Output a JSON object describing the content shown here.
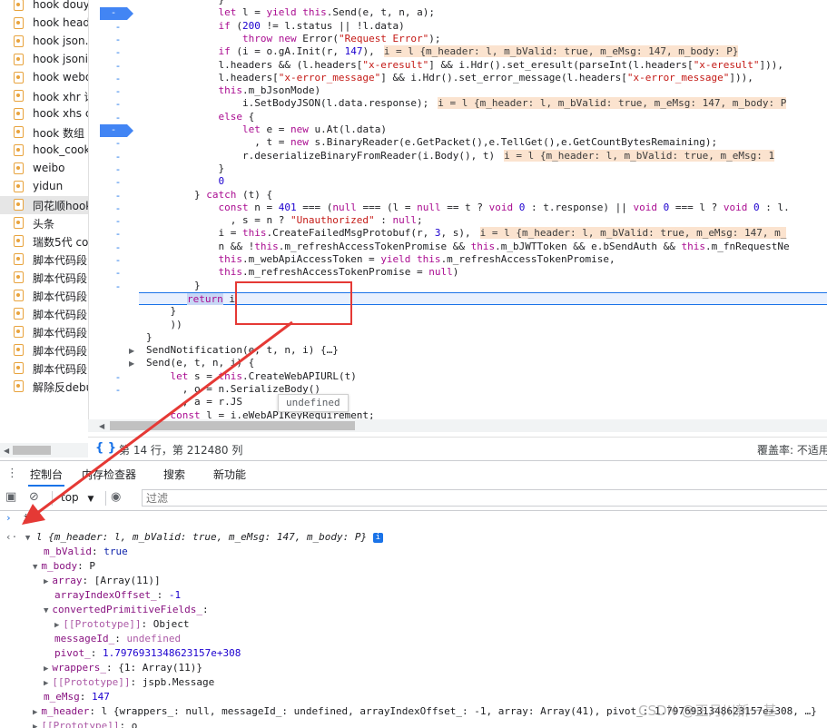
{
  "snippets": [
    {
      "name": "hook douyi"
    },
    {
      "name": "hook heade"
    },
    {
      "name": "hook json.p"
    },
    {
      "name": "hook jsonif"
    },
    {
      "name": "hook webd"
    },
    {
      "name": "hook xhr 请"
    },
    {
      "name": "hook xhs co"
    },
    {
      "name": "hook 数组"
    },
    {
      "name": "hook_cooki"
    },
    {
      "name": "weibo"
    },
    {
      "name": "yidun"
    },
    {
      "name": "同花顺hook",
      "selected": true
    },
    {
      "name": "头条"
    },
    {
      "name": "瑞数5代 co"
    },
    {
      "name": "脚本代码段"
    },
    {
      "name": "脚本代码段"
    },
    {
      "name": "脚本代码段"
    },
    {
      "name": "脚本代码段"
    },
    {
      "name": "脚本代码段"
    },
    {
      "name": "脚本代码段"
    },
    {
      "name": "脚本代码段"
    },
    {
      "name": "解除反debu"
    }
  ],
  "editor": {
    "lines": [
      "            }",
      "            let l = yield this.Send(e, t, n, a);",
      "            if (200 != l.status || !l.data)",
      "                throw new Error(\"Request Error\");",
      "            if (i = o.gA.Init(r, 147),",
      "            l.headers && (l.headers[\"x-eresult\"] && i.Hdr().set_eresult(parseInt(l.headers[\"x-eresult\"])),",
      "            l.headers[\"x-error_message\"] && i.Hdr().set_error_message(l.headers[\"x-error_message\"])),",
      "            this.m_bJsonMode)",
      "                i.SetBodyJSON(l.data.response);",
      "            else {",
      "                let e = new u.At(l.data)",
      "                  , t = new s.BinaryReader(e.GetPacket(),e.TellGet(),e.GetCountBytesRemaining);",
      "                r.deserializeBinaryFromReader(i.Body(), t)",
      "            }",
      "            0",
      "        } catch (t) {",
      "            const n = 401 === (null === (l = null == t ? void 0 : t.response) || void 0 === l ? void 0 : l.",
      "              , s = n ? \"Unauthorized\" : null;",
      "            i = this.CreateFailedMsgProtobuf(r, 3, s),",
      "            n && !this.m_refreshAccessTokenPromise && this.m_bJWTToken && e.bSendAuth && this.m_fnRequestNe",
      "            this.m_webApiAccessToken = yield this.m_refreshAccessTokenPromise,",
      "            this.m_refreshAccessTokenPromise = null)",
      "        }",
      "        return i",
      "    }",
      "    ))",
      "}",
      "SendNotification(e, t, n, i) {…}",
      "Send(e, t, n, i) {",
      "    let s = this.CreateWebAPIURL(t)",
      "      , o = n.SerializeBody()",
      "      , a = r.JS",
      "    const l = i.eWebAPIKeyRequirement;"
    ],
    "annotations": {
      "4": "i = l {m_header: l, m_bValid: true, m_eMsg: 147, m_body: P}",
      "8": "i = l {m_header: l, m_bValid: true, m_eMsg: 147, m_body: P",
      "12": "i = l {m_header: l, m_bValid: true, m_eMsg: 1",
      "18": "i = l {m_header: l, m_bValid: true, m_eMsg: 147, m_"
    },
    "tooltip": "undefined"
  },
  "status": {
    "position": "第 14 行，第 212480 列",
    "coverage": "覆盖率: 不适用"
  },
  "drawer_tabs": [
    "控制台",
    "内存检查器",
    "搜索",
    "新功能"
  ],
  "console_toolbar": {
    "context": "top",
    "filter_placeholder": "过滤"
  },
  "console": {
    "input": "i",
    "summary": "l {m_header: l, m_bValid: true, m_eMsg: 147, m_body: P}",
    "rows": [
      {
        "indent": 1,
        "toggle": "",
        "key": "m_bValid",
        "value": "true",
        "vtype": "kw"
      },
      {
        "indent": 1,
        "toggle": "▼",
        "key": "m_body",
        "value": "P",
        "vtype": "plain"
      },
      {
        "indent": 2,
        "toggle": "▶",
        "key": "array",
        "value": "[Array(11)]",
        "vtype": "plain"
      },
      {
        "indent": 2,
        "toggle": "",
        "key": "arrayIndexOffset_",
        "value": "-1",
        "vtype": "num"
      },
      {
        "indent": 2,
        "toggle": "▼",
        "key": "convertedPrimitiveFields_",
        "value": "",
        "vtype": "plain"
      },
      {
        "indent": 3,
        "toggle": "▶",
        "key": "[[Prototype]]",
        "value": "Object",
        "vtype": "plain",
        "dim": true
      },
      {
        "indent": 2,
        "toggle": "",
        "key": "messageId_",
        "value": "undefined",
        "vtype": "dim"
      },
      {
        "indent": 2,
        "toggle": "",
        "key": "pivot_",
        "value": "1.7976931348623157e+308",
        "vtype": "num"
      },
      {
        "indent": 2,
        "toggle": "▶",
        "key": "wrappers_",
        "value": "{1: Array(11)}",
        "vtype": "plain"
      },
      {
        "indent": 2,
        "toggle": "▶",
        "key": "[[Prototype]]",
        "value": "jspb.Message",
        "vtype": "plain",
        "dim": true
      },
      {
        "indent": 1,
        "toggle": "",
        "key": "m_eMsg",
        "value": "147",
        "vtype": "num"
      },
      {
        "indent": 1,
        "toggle": "▶",
        "key": "m_header",
        "value": "l {wrappers_: null, messageId_: undefined, arrayIndexOffset_: -1, array: Array(41), pivot_: 1.7976931348623157e+308, …}",
        "vtype": "plain"
      },
      {
        "indent": 1,
        "toggle": "▶",
        "key": "[[Prototype]]",
        "value": "o",
        "vtype": "plain",
        "dim": true
      }
    ]
  },
  "watermark": "CSDN @正月川新一基",
  "colors": {
    "accent": "#1a73e8",
    "highlight_box": "#e53935",
    "annotation_bg": "#fbe3cf"
  }
}
